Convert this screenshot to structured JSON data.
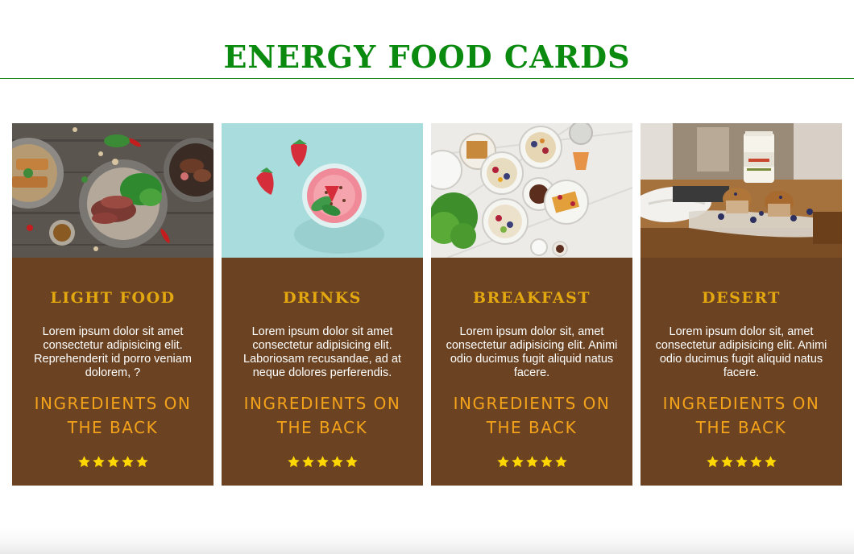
{
  "header": {
    "title": "ENERGY FOOD CARDS",
    "accent_color": "#0b8a10"
  },
  "colors": {
    "card_background": "#6b4322",
    "card_title": "#e3a70f",
    "card_link": "#f3a21a",
    "star": "#ffd700"
  },
  "cards": [
    {
      "title": "LIGHT FOOD",
      "image": "grilled-meat-salad-platter-photo",
      "text": "Lorem ipsum dolor sit amet consectetur adipisicing elit. Reprehenderit id porro veniam dolorem, ?",
      "link": "INGREDIENTS ON THE BACK",
      "rating": 5,
      "rating_max": 5
    },
    {
      "title": "DRINKS",
      "image": "strawberry-smoothie-glass-photo",
      "text": "Lorem ipsum dolor sit amet consectetur adipisicing elit. Laboriosam recusandae, ad at neque dolores perferendis.",
      "link": "INGREDIENTS ON THE BACK",
      "rating": 5,
      "rating_max": 5
    },
    {
      "title": "BREAKFAST",
      "image": "breakfast-bowls-waffles-photo",
      "text": "Lorem ipsum dolor sit, amet consectetur adipisicing elit. Animi odio ducimus fugit aliquid natus facere.",
      "link": "INGREDIENTS ON THE BACK",
      "rating": 5,
      "rating_max": 5
    },
    {
      "title": "DESERT",
      "image": "muffins-protein-jar-photo",
      "text": "Lorem ipsum dolor sit, amet consectetur adipisicing elit. Animi odio ducimus fugit aliquid natus facere.",
      "link": "INGREDIENTS ON THE BACK",
      "rating": 5,
      "rating_max": 5
    }
  ]
}
